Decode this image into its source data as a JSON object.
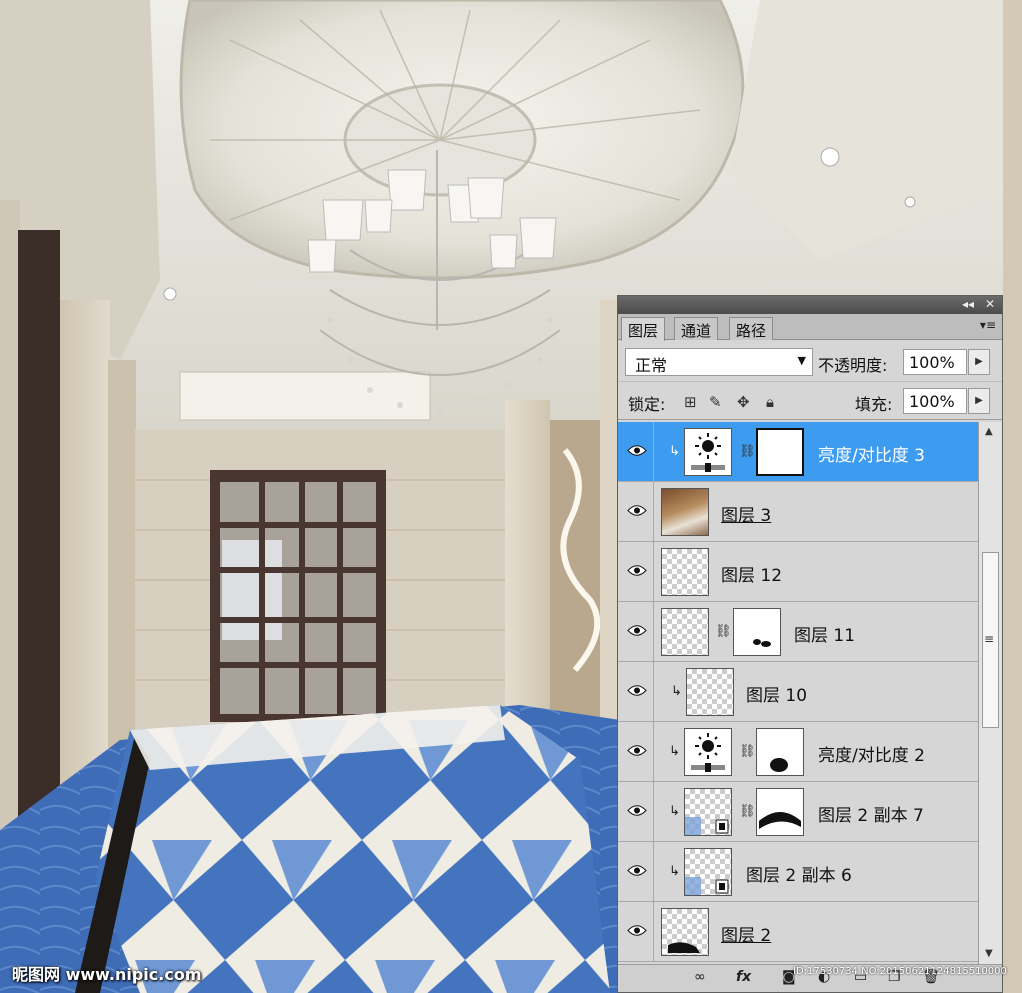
{
  "panel": {
    "tabs": [
      {
        "label": "图层",
        "active": true
      },
      {
        "label": "通道",
        "active": false
      },
      {
        "label": "路径",
        "active": false
      }
    ],
    "title_buttons": {
      "collapse": "◂◂",
      "close": "✕"
    },
    "menu_icon": "▾≡",
    "blend_mode": "正常",
    "opacity_label": "不透明度:",
    "opacity_value": "100%",
    "lock_label": "锁定:",
    "fill_label": "填充:",
    "fill_value": "100%",
    "layers": [
      {
        "name": "亮度/对比度 3",
        "type": "adjustment",
        "clipped": true,
        "selected": true,
        "mask": "white"
      },
      {
        "name": "图层 3",
        "type": "image",
        "clipped": false,
        "selected": false
      },
      {
        "name": "图层 12",
        "type": "transparent",
        "clipped": false,
        "selected": false
      },
      {
        "name": "图层 11",
        "type": "transparent",
        "clipped": false,
        "selected": false,
        "mask": "spots"
      },
      {
        "name": "图层 10",
        "type": "transparent",
        "clipped": true,
        "selected": false
      },
      {
        "name": "亮度/对比度 2",
        "type": "adjustment",
        "clipped": true,
        "selected": false,
        "mask": "blob"
      },
      {
        "name": "图层 2 副本 7",
        "type": "smart",
        "clipped": true,
        "selected": false,
        "mask": "arc"
      },
      {
        "name": "图层 2 副本 6",
        "type": "smart",
        "clipped": true,
        "selected": false
      },
      {
        "name": "图层 2",
        "type": "transparent",
        "clipped": false,
        "selected": false
      }
    ],
    "bottom_icons": [
      "link-icon",
      "fx-icon",
      "mask-icon",
      "adjustment-icon",
      "group-icon",
      "new-layer-icon",
      "delete-icon"
    ],
    "fx_label": "fx"
  },
  "watermark": "昵图网 www.nipic.com",
  "image_id": "ID:17530734 NO:20150621124815510000",
  "colors": {
    "selection": "#3d9cf0",
    "panel_bg": "#d6d6d6",
    "floor_blue": "#3f6fb8"
  }
}
